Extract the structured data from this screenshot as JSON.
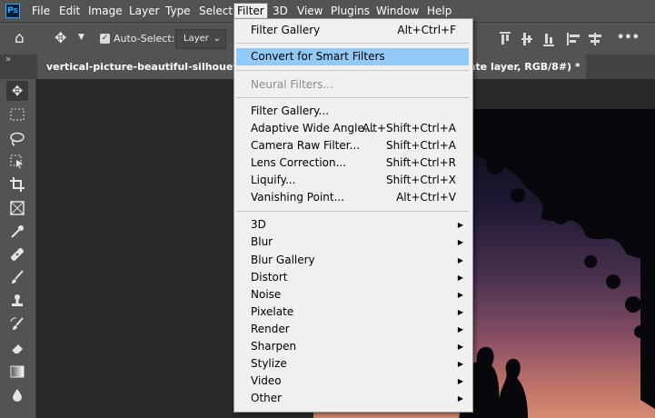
{
  "app": {
    "logo": "Ps"
  },
  "menubar": {
    "items": [
      "File",
      "Edit",
      "Image",
      "Layer",
      "Type",
      "Select",
      "Filter",
      "3D",
      "View",
      "Plugins",
      "Window",
      "Help"
    ],
    "active": "Filter"
  },
  "options_bar": {
    "auto_select_label": "Auto-Select:",
    "auto_select_checked": true,
    "layer_dropdown_value": "Layer",
    "more_label": "•••"
  },
  "document": {
    "tab_title_left": "vertical-picture-beautiful-silhouettes-lo",
    "tab_title_right": "ate layer, RGB/8#) *",
    "close_label": "×"
  },
  "panel_collapse_label": "»",
  "tools": [
    "move-tool",
    "marquee-tool",
    "lasso-tool",
    "object-select-tool",
    "crop-tool",
    "frame-tool",
    "eyedropper-tool",
    "healing-tool",
    "brush-tool",
    "stamp-tool",
    "history-brush-tool",
    "eraser-tool",
    "gradient-tool",
    "blur-tool"
  ],
  "filter_menu": {
    "items": [
      {
        "label": "Filter Gallery",
        "shortcut": "Alt+Ctrl+F"
      },
      {
        "separator": true
      },
      {
        "label": "Convert for Smart Filters",
        "highlighted": true
      },
      {
        "separator": true
      },
      {
        "label": "Neural Filters...",
        "disabled": true
      },
      {
        "separator": true
      },
      {
        "label": "Filter Gallery..."
      },
      {
        "label": "Adaptive Wide Angle...",
        "shortcut": "Alt+Shift+Ctrl+A"
      },
      {
        "label": "Camera Raw Filter...",
        "shortcut": "Shift+Ctrl+A"
      },
      {
        "label": "Lens Correction...",
        "shortcut": "Shift+Ctrl+R"
      },
      {
        "label": "Liquify...",
        "shortcut": "Shift+Ctrl+X"
      },
      {
        "label": "Vanishing Point...",
        "shortcut": "Alt+Ctrl+V"
      },
      {
        "separator": true
      },
      {
        "label": "3D",
        "submenu": true
      },
      {
        "label": "Blur",
        "submenu": true
      },
      {
        "label": "Blur Gallery",
        "submenu": true
      },
      {
        "label": "Distort",
        "submenu": true
      },
      {
        "label": "Noise",
        "submenu": true
      },
      {
        "label": "Pixelate",
        "submenu": true
      },
      {
        "label": "Render",
        "submenu": true
      },
      {
        "label": "Sharpen",
        "submenu": true
      },
      {
        "label": "Stylize",
        "submenu": true
      },
      {
        "label": "Video",
        "submenu": true
      },
      {
        "label": "Other",
        "submenu": true
      }
    ],
    "submenu_arrow": "▶"
  },
  "colors": {
    "highlight": "#91c9f7",
    "menu_bg": "#f0f0f0",
    "chrome": "#535353"
  }
}
